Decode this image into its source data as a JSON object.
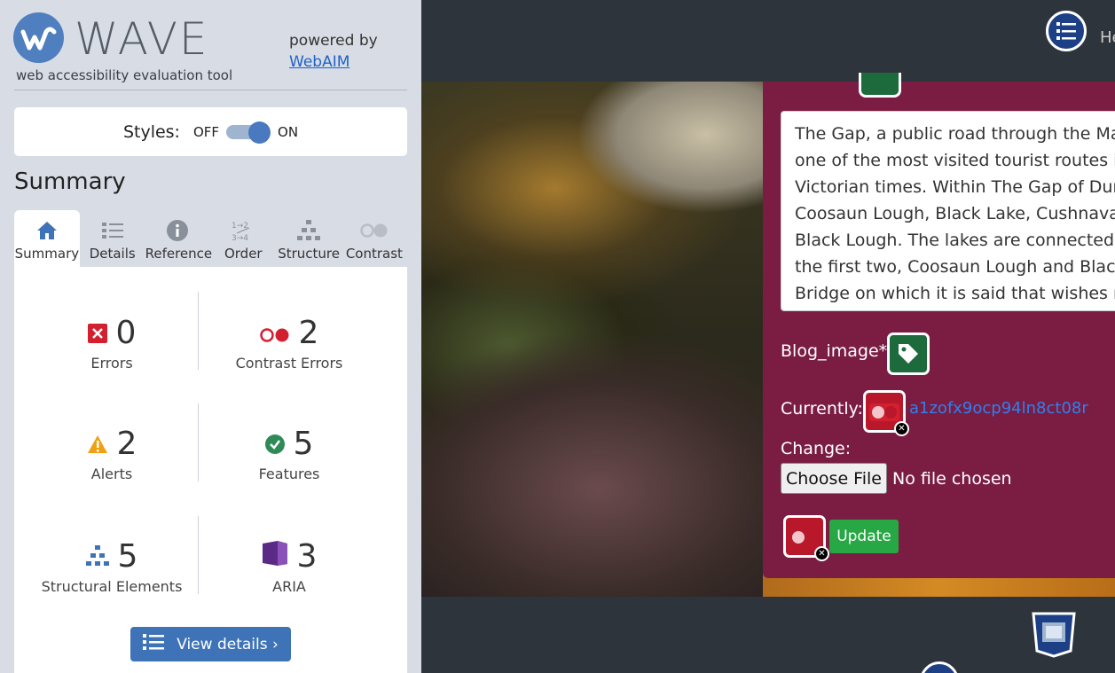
{
  "wave": {
    "title": "WAVE",
    "subtitle": "web accessibility evaluation tool",
    "powered_by": "powered by",
    "webaim_link": "WebAIM",
    "styles_label": "Styles:",
    "toggle_off": "OFF",
    "toggle_on": "ON",
    "summary_heading": "Summary",
    "tabs": [
      {
        "label": "Summary",
        "icon": "home-icon"
      },
      {
        "label": "Details",
        "icon": "list-icon"
      },
      {
        "label": "Reference",
        "icon": "info-icon"
      },
      {
        "label": "Order",
        "icon": "order-icon"
      },
      {
        "label": "Structure",
        "icon": "structure-icon"
      },
      {
        "label": "Contrast",
        "icon": "contrast-icon"
      }
    ],
    "stats": {
      "errors": {
        "count": "0",
        "label": "Errors"
      },
      "contrast_errors": {
        "count": "2",
        "label": "Contrast Errors"
      },
      "alerts": {
        "count": "2",
        "label": "Alerts"
      },
      "features": {
        "count": "5",
        "label": "Features"
      },
      "structural": {
        "count": "5",
        "label": "Structural Elements"
      },
      "aria": {
        "count": "3",
        "label": "ARIA"
      }
    },
    "view_details": "View details ›"
  },
  "page": {
    "topbar_text": "He",
    "textarea_lines": [
      "The Gap, a public road through the MacG",
      "one of the most visited tourist routes in Ir",
      "Victorian times. Within The Gap of Dunlo",
      "Coosaun Lough, Black Lake, Cushnavally L",
      "Black Lough. The lakes are connected by",
      "the first two, Coosaun Lough and Black La",
      "Bridge on which it is said that wishes mad"
    ],
    "blog_image_label": "Blog_image*",
    "currently_label": "Currently:",
    "current_file": "a1zofx9ocp94ln8ct08r",
    "change_label": "Change:",
    "choose_file": "Choose File",
    "no_file": "No file chosen",
    "update_button": "Update"
  },
  "colors": {
    "accent_blue": "#3f73b8",
    "card_maroon": "#7b1d43",
    "error_red": "#d32030",
    "feature_green": "#1d6b3c",
    "update_green": "#28a745"
  }
}
